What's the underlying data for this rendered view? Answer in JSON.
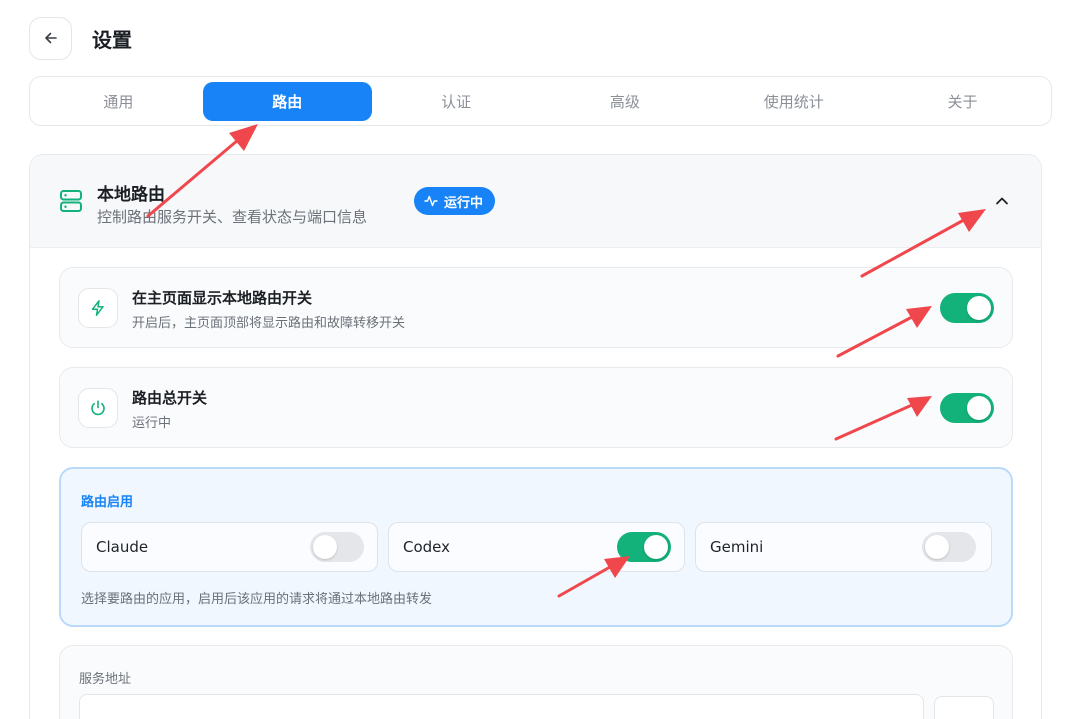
{
  "header": {
    "title": "设置"
  },
  "tabs": [
    {
      "label": "通用",
      "active": false
    },
    {
      "label": "路由",
      "active": true
    },
    {
      "label": "认证",
      "active": false
    },
    {
      "label": "高级",
      "active": false
    },
    {
      "label": "使用统计",
      "active": false
    },
    {
      "label": "关于",
      "active": false
    }
  ],
  "local_routing": {
    "title": "本地路由",
    "subtitle": "控制路由服务开关、查看状态与端口信息",
    "status_badge": "运行中",
    "expanded": true
  },
  "settings": [
    {
      "title": "在主页面显示本地路由开关",
      "description": "开启后，主页面顶部将显示路由和故障转移开关",
      "icon": "lightning-icon",
      "enabled": true
    },
    {
      "title": "路由总开关",
      "description": "运行中",
      "icon": "power-icon",
      "enabled": true
    }
  ],
  "routing_apps": {
    "title": "路由启用",
    "apps": [
      {
        "name": "Claude",
        "enabled": false
      },
      {
        "name": "Codex",
        "enabled": true
      },
      {
        "name": "Gemini",
        "enabled": false
      }
    ],
    "note": "选择要路由的应用，启用后该应用的请求将通过本地路由转发"
  },
  "service_address": {
    "label": "服务地址"
  },
  "colors": {
    "accent": "#1783f6",
    "toggle_on": "#13b27a",
    "toggle_off": "#e4e6e9",
    "annotation_arrow": "#f0474d"
  }
}
